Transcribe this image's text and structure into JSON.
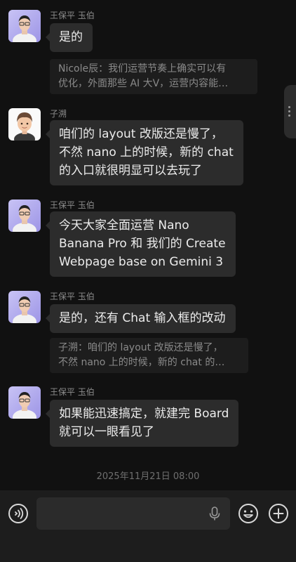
{
  "messages": [
    {
      "sender": "王保平 玉伯",
      "text_lines": [
        "是的"
      ],
      "quote_lines": [
        "Nicole辰：我们运营节奏上确实可以有",
        "优化，外面那些 AI 大V，运营内容能…"
      ]
    },
    {
      "sender": "子溯",
      "text_lines": [
        "咱们的 layout 改版还是慢了，",
        "不然 nano 上的时候，新的 chat",
        "的入口就很明显可以去玩了"
      ]
    },
    {
      "sender": "王保平 玉伯",
      "text_lines": [
        "今天大家全面运营 Nano",
        "Banana Pro 和 我们的 Create",
        "Webpage base on Gemini 3"
      ]
    },
    {
      "sender": "王保平 玉伯",
      "text_lines": [
        "是的，还有 Chat 输入框的改动"
      ],
      "quote_lines": [
        "子溯：咱们的 layout 改版还是慢了，",
        "不然 nano 上的时候，新的 chat 的…"
      ]
    },
    {
      "sender": "王保平 玉伯",
      "text_lines": [
        "如果能迅速搞定，就建完 Board",
        "就可以一眼看见了"
      ]
    }
  ],
  "timestamp": "2025年11月21日 08:00",
  "input": {
    "placeholder": "",
    "voice_icon": "voice-mode-icon",
    "mic_icon": "microphone-icon",
    "emoji_icon": "emoji-icon",
    "plus_icon": "plus-icon"
  },
  "colors": {
    "background": "#111111",
    "bubble": "#2c2c2c",
    "quote": "#1d1d1d",
    "input_bar": "#1d1d1d"
  }
}
